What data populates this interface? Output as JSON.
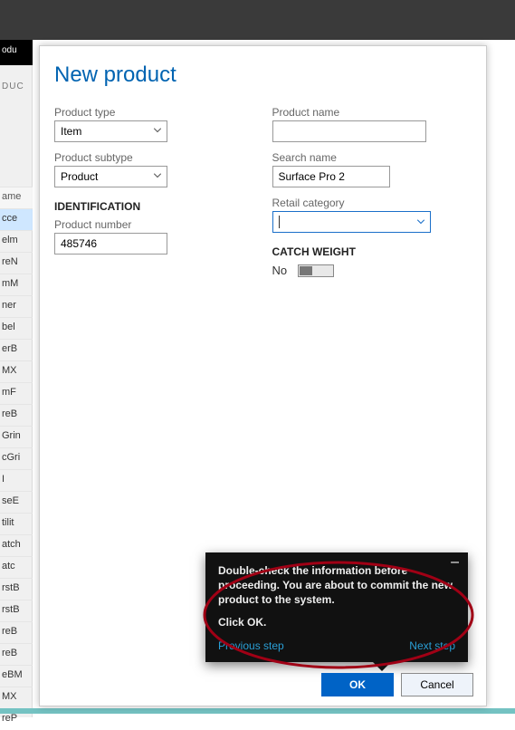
{
  "sideStrip": {
    "blackBox": "odu",
    "greyLabel": "DUC",
    "listHeader": "ame",
    "items": [
      "cce",
      "elm",
      "reN",
      "mM",
      "ner",
      "bel",
      "erB",
      "MX",
      "mF",
      "reB",
      "Grin",
      "cGri",
      "I",
      "seE",
      "tilit",
      "atch",
      "atc",
      "rstB",
      "rstB",
      "reB",
      "reB",
      "eBM",
      "MX",
      "reP"
    ]
  },
  "dialog": {
    "title": "New product",
    "fields": {
      "productType": {
        "label": "Product type",
        "value": "Item"
      },
      "productSubtype": {
        "label": "Product subtype",
        "value": "Product"
      },
      "productName": {
        "label": "Product name",
        "value": ""
      },
      "searchName": {
        "label": "Search name",
        "value": "Surface Pro 2"
      },
      "retailCategory": {
        "label": "Retail category",
        "value": ""
      },
      "productNumber": {
        "label": "Product number",
        "value": "485746"
      }
    },
    "sections": {
      "identification": "IDENTIFICATION",
      "catchWeight": "CATCH WEIGHT"
    },
    "catchWeight": {
      "stateLabel": "No",
      "on": false
    },
    "actions": {
      "ok": "OK",
      "cancel": "Cancel"
    }
  },
  "tooltip": {
    "body": "Double-check the information before proceeding. You are about to commit the new product to the system.",
    "action": "Click OK.",
    "prev": "Previous step",
    "next": "Next step",
    "minimize": "–"
  }
}
